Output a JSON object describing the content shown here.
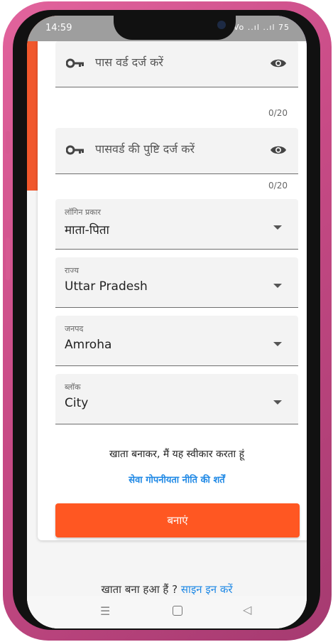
{
  "status_bar": {
    "time": "14:59",
    "icons_text": "Vo ..ıl ..ıl 75"
  },
  "password_field": {
    "label": "पास वर्ड दर्ज करें",
    "counter": "0/20"
  },
  "confirm_password_field": {
    "label": "पासवर्ड की पुष्टि दर्ज करें",
    "counter": "0/20"
  },
  "login_type": {
    "label": "लॉगिन प्रकार",
    "value": "माता-पिता"
  },
  "state": {
    "label": "राज्य",
    "value": "Uttar Pradesh"
  },
  "district": {
    "label": "जनपद",
    "value": "Amroha"
  },
  "block": {
    "label": "ब्लॉक",
    "value": "City"
  },
  "terms": {
    "text": "खाता बनाकर, मैं यह स्वीकार करता हूं",
    "link": "सेवा गोपनीयता नीति की शर्तें"
  },
  "create_button": {
    "label": "बनाएं"
  },
  "signin": {
    "prompt": "खाता बना हआ हैं ?",
    "link": "साइन इन करें"
  },
  "nav": {
    "menu": "☰",
    "back": "◁"
  },
  "colors": {
    "accent": "#ff5722",
    "link": "#1e88e5",
    "gradient_start": "#f2572b",
    "gradient_end": "#7b3fc0"
  }
}
